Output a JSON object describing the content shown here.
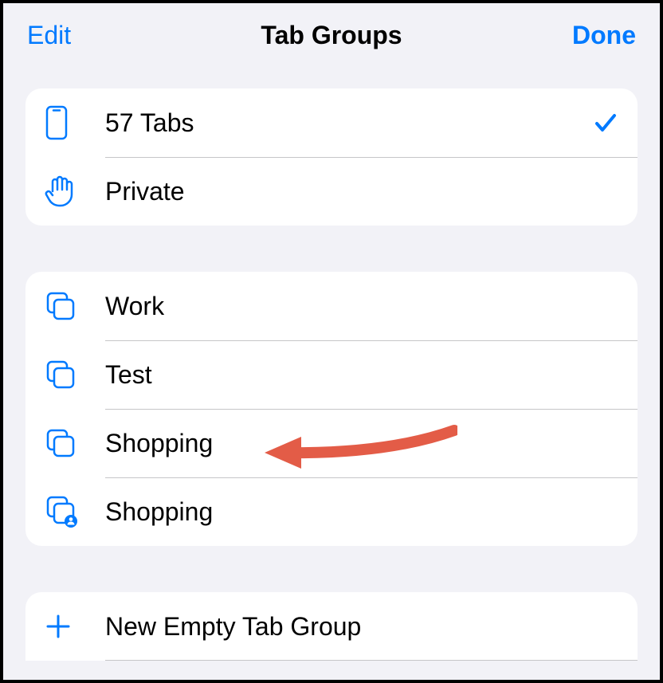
{
  "header": {
    "edit_label": "Edit",
    "title": "Tab Groups",
    "done_label": "Done"
  },
  "system_groups": [
    {
      "label": "57 Tabs",
      "icon": "phone-icon",
      "selected": true
    },
    {
      "label": "Private",
      "icon": "hand-icon",
      "selected": false
    }
  ],
  "custom_groups": [
    {
      "label": "Work",
      "icon": "group-icon",
      "shared": false
    },
    {
      "label": "Test",
      "icon": "group-icon",
      "shared": false
    },
    {
      "label": "Shopping",
      "icon": "group-icon",
      "shared": false
    },
    {
      "label": "Shopping",
      "icon": "group-shared-icon",
      "shared": true
    }
  ],
  "new_group": {
    "label": "New Empty Tab Group",
    "icon": "plus-icon"
  },
  "colors": {
    "accent": "#007aff",
    "annotation": "#e35c47"
  }
}
